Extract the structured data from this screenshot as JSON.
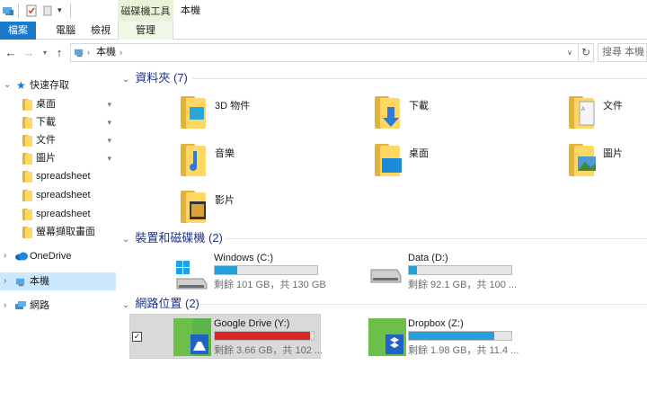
{
  "window": {
    "title": "本機",
    "context_tab": "磁碟機工具"
  },
  "ribbon": {
    "tabs": [
      "檔案",
      "電腦",
      "檢視",
      "管理"
    ]
  },
  "address": {
    "crumb": "本機",
    "search_placeholder": "搜尋 本機"
  },
  "nav": {
    "quick_access": "快速存取",
    "quick_items": [
      {
        "label": "桌面",
        "pinned": true
      },
      {
        "label": "下載",
        "pinned": true
      },
      {
        "label": "文件",
        "pinned": true
      },
      {
        "label": "圖片",
        "pinned": true
      },
      {
        "label": "spreadsheet",
        "pinned": false
      },
      {
        "label": "spreadsheet",
        "pinned": false
      },
      {
        "label": "spreadsheet",
        "pinned": false
      },
      {
        "label": "螢幕擷取畫面",
        "pinned": false
      }
    ],
    "onedrive": "OneDrive",
    "this_pc": "本機",
    "network": "網路"
  },
  "sections": {
    "folders": {
      "title": "資料夾 (7)",
      "items": [
        "3D 物件",
        "下載",
        "文件",
        "音樂",
        "桌面",
        "圖片",
        "影片"
      ]
    },
    "devices": {
      "title": "裝置和磁碟機 (2)",
      "drives": [
        {
          "name": "Windows (C:)",
          "free": "剩餘 101 GB，共 130 GB",
          "used_fraction": 0.22
        },
        {
          "name": "Data (D:)",
          "free": "剩餘 92.1 GB，共 100 ...",
          "used_fraction": 0.08
        }
      ]
    },
    "network": {
      "title": "網路位置 (2)",
      "drives": [
        {
          "name": "Google Drive (Y:)",
          "free": "剩餘 3.66 GB，共 102 ...",
          "used_fraction": 0.96,
          "selected": true
        },
        {
          "name": "Dropbox (Z:)",
          "free": "剩餘 1.98 GB，共 11.4 ...",
          "used_fraction": 0.83
        }
      ]
    }
  },
  "colors": {
    "accent": "#1979ca",
    "bar_normal": "#26a0da",
    "bar_full": "#da2626",
    "section_title": "#1e3287"
  },
  "glyphs": {
    "check": "✓",
    "pin": "📌"
  }
}
